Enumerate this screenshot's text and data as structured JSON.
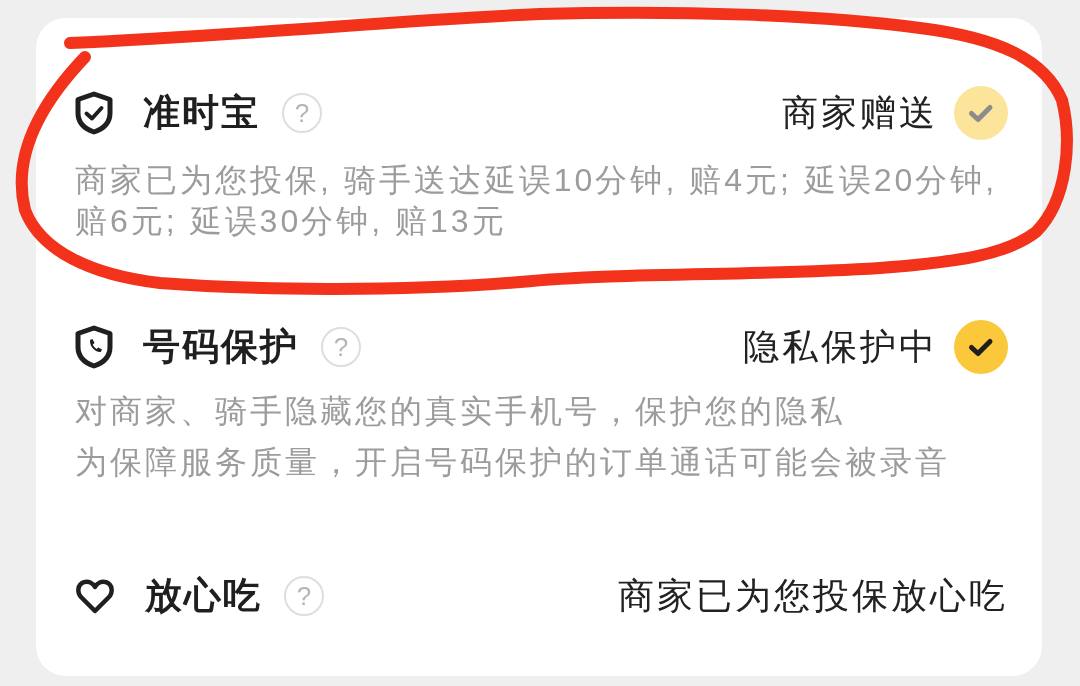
{
  "services": [
    {
      "kind": "check",
      "title": "准时宝",
      "help": "?",
      "status": "商家赠送",
      "checked": true,
      "disabled": true,
      "description": [
        "商家已为您投保, 骑手送达延误10分钟, 赔4元; 延误20分钟, 赔6元; 延误30分钟, 赔13元"
      ]
    },
    {
      "kind": "check",
      "title": "号码保护",
      "help": "?",
      "status": "隐私保护中",
      "checked": true,
      "disabled": false,
      "description": [
        "对商家、骑手隐藏您的真实手机号，保护您的隐私",
        "为保障服务质量，开启号码保护的订单通话可能会被录音"
      ]
    },
    {
      "kind": "plain",
      "title": "放心吃",
      "help": "?",
      "status": "商家已为您投保放心吃"
    }
  ]
}
